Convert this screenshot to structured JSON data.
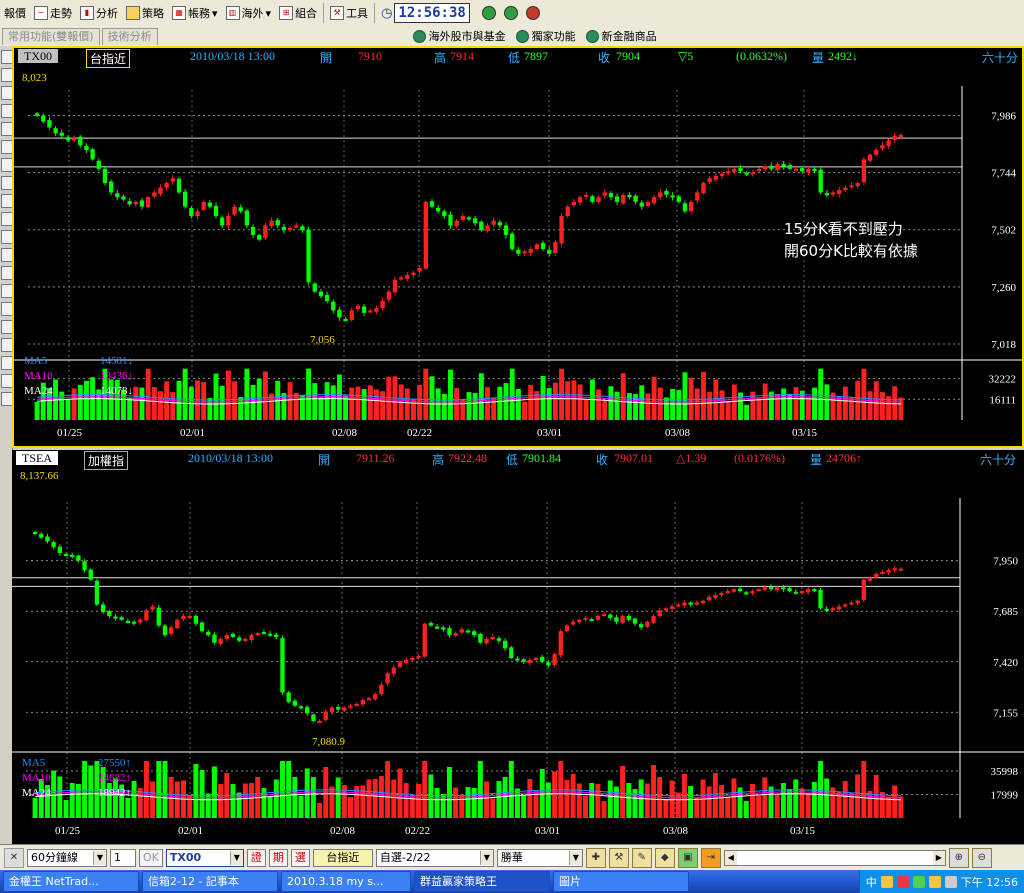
{
  "toolbar": {
    "items": [
      "報價",
      "走勢",
      "分析",
      "策略",
      "帳務",
      "海外",
      "組合",
      "工具"
    ],
    "clock": "12:56:38"
  },
  "toolbar2": {
    "tabs": [
      "常用功能(雙報價)",
      "技術分析"
    ],
    "links": [
      "海外股市與基金",
      "獨家功能",
      "新金融商品"
    ]
  },
  "colors": {
    "up": "#ff2020",
    "down": "#00ff00",
    "frame": "#ffd700",
    "ma5": "#1e90ff",
    "ma10": "#ff00ff",
    "ma24": "#ffffff"
  },
  "chart1": {
    "symbol": "TX00",
    "sub": "台指近",
    "datetime": "2010/03/18 13:00",
    "open_label": "開",
    "open": "7910",
    "high_label": "高",
    "high": "7914",
    "low_label": "低",
    "low": "7897",
    "close_label": "收",
    "close": "7904",
    "change": "▽5",
    "change_pct": "(0.0632%)",
    "volume_label": "量",
    "volume": "2492↓",
    "period": "六十分",
    "hi_mark": "8,023",
    "lo_mark": "7,056",
    "annotation_line1": "15分K看不到壓力",
    "annotation_line2": "開60分K比較有依據",
    "ma": [
      {
        "name": "MA5",
        "value": "14581↓"
      },
      {
        "name": "MA10",
        "value": "13436↓"
      },
      {
        "name": "MA24",
        "value": "14078↓"
      }
    ]
  },
  "chart2": {
    "symbol": "TSEA",
    "sub": "加權指",
    "datetime": "2010/03/18 13:00",
    "open_label": "開",
    "open": "7911.26",
    "high_label": "高",
    "high": "7922.48",
    "low_label": "低",
    "low": "7901.84",
    "close_label": "收",
    "close": "7907.01",
    "change": "△1.39",
    "change_pct": "(0.0176%)",
    "volume_label": "量",
    "volume": "24706↑",
    "period": "六十分",
    "hi_mark": "8,137.66",
    "lo_mark": "7,080.9",
    "ma": [
      {
        "name": "MA5",
        "value": "27550↑"
      },
      {
        "name": "MA10",
        "value": "24682↑"
      },
      {
        "name": "MA24",
        "value": "18942↑"
      }
    ]
  },
  "chart_data": [
    {
      "type": "candlestick",
      "title": "TX00 台指近",
      "y_ticks": [
        7986,
        7744,
        7502,
        7260,
        7018
      ],
      "ylim": [
        7018,
        8060
      ],
      "x_ticks": [
        "01/25",
        "02/01",
        "02/08",
        "02/22",
        "03/01",
        "03/08",
        "03/15"
      ],
      "volume_ticks": [
        32222,
        16111
      ],
      "volume_max": 42000,
      "support_lines": [
        7890,
        7768
      ],
      "close": [
        7985,
        7960,
        7935,
        7910,
        7900,
        7880,
        7890,
        7860,
        7840,
        7800,
        7760,
        7700,
        7660,
        7640,
        7630,
        7610,
        7620,
        7600,
        7640,
        7660,
        7680,
        7700,
        7720,
        7660,
        7600,
        7560,
        7580,
        7620,
        7600,
        7560,
        7520,
        7560,
        7600,
        7580,
        7520,
        7480,
        7460,
        7520,
        7540,
        7520,
        7500,
        7510,
        7520,
        7500,
        7280,
        7240,
        7220,
        7200,
        7160,
        7130,
        7120,
        7160,
        7180,
        7150,
        7160,
        7170,
        7200,
        7240,
        7290,
        7300,
        7310,
        7320,
        7340,
        7620,
        7600,
        7580,
        7560,
        7520,
        7540,
        7560,
        7550,
        7530,
        7500,
        7520,
        7540,
        7520,
        7480,
        7420,
        7400,
        7410,
        7420,
        7440,
        7420,
        7400,
        7450,
        7560,
        7600,
        7620,
        7640,
        7650,
        7620,
        7640,
        7660,
        7640,
        7620,
        7650,
        7640,
        7620,
        7600,
        7620,
        7640,
        7660,
        7650,
        7640,
        7620,
        7580,
        7620,
        7660,
        7700,
        7720,
        7730,
        7740,
        7750,
        7760,
        7750,
        7740,
        7745,
        7760,
        7770,
        7760,
        7780,
        7770,
        7760,
        7760,
        7750,
        7760,
        7750,
        7660,
        7650,
        7660,
        7670,
        7680,
        7690,
        7700,
        7800,
        7820,
        7840,
        7860,
        7880,
        7900,
        7904
      ]
    },
    {
      "type": "candlestick",
      "title": "TSEA 加權指",
      "y_ticks": [
        7950,
        7685,
        7420,
        7155
      ],
      "ylim": [
        7000,
        8215
      ],
      "x_ticks": [
        "01/25",
        "02/01",
        "02/08",
        "02/22",
        "03/01",
        "03/08",
        "03/15"
      ],
      "volume_ticks": [
        35998,
        17999
      ],
      "volume_max": 46000,
      "support_lines": [
        7860,
        7815
      ],
      "close": [
        8090,
        8070,
        8050,
        8020,
        7990,
        7980,
        7970,
        7950,
        7900,
        7850,
        7720,
        7680,
        7660,
        7650,
        7640,
        7630,
        7620,
        7640,
        7690,
        7710,
        7610,
        7560,
        7600,
        7640,
        7660,
        7660,
        7620,
        7580,
        7560,
        7520,
        7540,
        7560,
        7550,
        7530,
        7540,
        7560,
        7570,
        7570,
        7560,
        7550,
        7260,
        7210,
        7190,
        7180,
        7150,
        7110,
        7110,
        7160,
        7180,
        7170,
        7180,
        7190,
        7200,
        7220,
        7230,
        7250,
        7300,
        7360,
        7390,
        7420,
        7430,
        7440,
        7450,
        7620,
        7610,
        7600,
        7590,
        7560,
        7570,
        7590,
        7580,
        7560,
        7520,
        7540,
        7550,
        7530,
        7490,
        7440,
        7430,
        7420,
        7430,
        7440,
        7420,
        7400,
        7460,
        7580,
        7610,
        7630,
        7640,
        7650,
        7640,
        7660,
        7670,
        7650,
        7630,
        7660,
        7640,
        7620,
        7600,
        7630,
        7660,
        7690,
        7700,
        7710,
        7720,
        7730,
        7720,
        7730,
        7740,
        7760,
        7770,
        7780,
        7790,
        7800,
        7790,
        7780,
        7790,
        7800,
        7810,
        7800,
        7810,
        7800,
        7790,
        7780,
        7790,
        7800,
        7790,
        7700,
        7690,
        7700,
        7710,
        7720,
        7730,
        7740,
        7850,
        7860,
        7880,
        7890,
        7900,
        7910,
        7907
      ]
    }
  ],
  "bottom": {
    "period_select": "60分鐘線",
    "count": "1",
    "ok": "OK",
    "symbol": "TX00",
    "btn1": "證",
    "btn2": "期",
    "btn3": "選",
    "name": "台指近",
    "group": "自選-2/22",
    "broker": "勝華"
  },
  "taskbar": {
    "items": [
      "金權王 NetTrad...",
      "信箱2-12 - 記事本",
      "2010.3.18 my s...",
      "群益贏家策略王",
      "圖片"
    ],
    "ime": "中",
    "time": "下午 12:56"
  }
}
